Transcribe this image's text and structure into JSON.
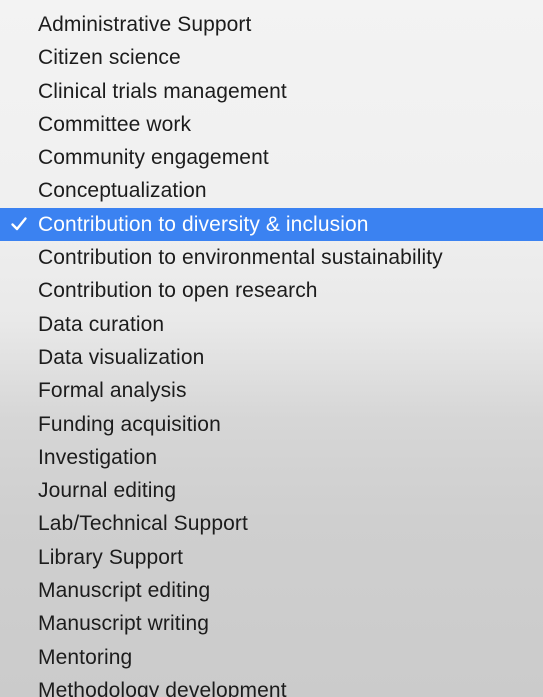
{
  "menu": {
    "selected_index": 6,
    "check_icon": "checkmark-icon",
    "colors": {
      "highlight": "#3b82f1",
      "text": "#1c1c1c",
      "highlight_text": "#ffffff"
    },
    "items": [
      {
        "label": "Administrative Support"
      },
      {
        "label": "Citizen science"
      },
      {
        "label": "Clinical trials management"
      },
      {
        "label": "Committee work"
      },
      {
        "label": "Community engagement"
      },
      {
        "label": "Conceptualization"
      },
      {
        "label": "Contribution to diversity & inclusion"
      },
      {
        "label": "Contribution to environmental sustainability"
      },
      {
        "label": "Contribution to open research"
      },
      {
        "label": "Data curation"
      },
      {
        "label": "Data visualization"
      },
      {
        "label": "Formal analysis"
      },
      {
        "label": "Funding acquisition"
      },
      {
        "label": "Investigation"
      },
      {
        "label": "Journal editing"
      },
      {
        "label": "Lab/Technical Support"
      },
      {
        "label": "Library Support"
      },
      {
        "label": "Manuscript editing"
      },
      {
        "label": "Manuscript writing"
      },
      {
        "label": "Mentoring"
      },
      {
        "label": "Methodology development"
      }
    ]
  }
}
